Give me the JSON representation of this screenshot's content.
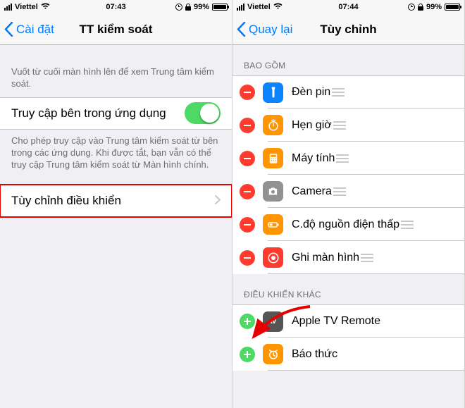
{
  "status": {
    "carrier": "Viettel",
    "time_left": "07:43",
    "time_right": "07:44",
    "battery_pct": "99%"
  },
  "left": {
    "back_label": "Cài đặt",
    "title": "TT kiểm soát",
    "swipe_hint": "Vuốt từ cuối màn hình lên để xem Trung tâm kiểm soát.",
    "access_row": "Truy cập bên trong ứng dụng",
    "access_note": "Cho phép truy cập vào Trung tâm kiểm soát từ bên trong các ứng dụng. Khi được tắt, bạn vẫn có thể truy cập Trung tâm kiểm soát từ Màn hình chính.",
    "customize_row": "Tùy chỉnh điều khiển"
  },
  "right": {
    "back_label": "Quay lại",
    "title": "Tùy chỉnh",
    "section_include": "BAO GỒM",
    "section_more": "ĐIỀU KHIỂN KHÁC",
    "include": [
      {
        "label": "Đèn pin",
        "icon": "flashlight",
        "bg": "#0a84ff"
      },
      {
        "label": "Hẹn giờ",
        "icon": "timer",
        "bg": "#ff9500"
      },
      {
        "label": "Máy tính",
        "icon": "calc",
        "bg": "#ff9500"
      },
      {
        "label": "Camera",
        "icon": "camera",
        "bg": "#929292"
      },
      {
        "label": "C.độ nguồn điện thấp",
        "icon": "battery",
        "bg": "#ff9500"
      },
      {
        "label": "Ghi màn hình",
        "icon": "record",
        "bg": "#ff3b30"
      }
    ],
    "more": [
      {
        "label": "Apple TV Remote",
        "icon": "atv",
        "bg": "#555555"
      },
      {
        "label": "Báo thức",
        "icon": "alarm",
        "bg": "#ff9500"
      }
    ]
  }
}
